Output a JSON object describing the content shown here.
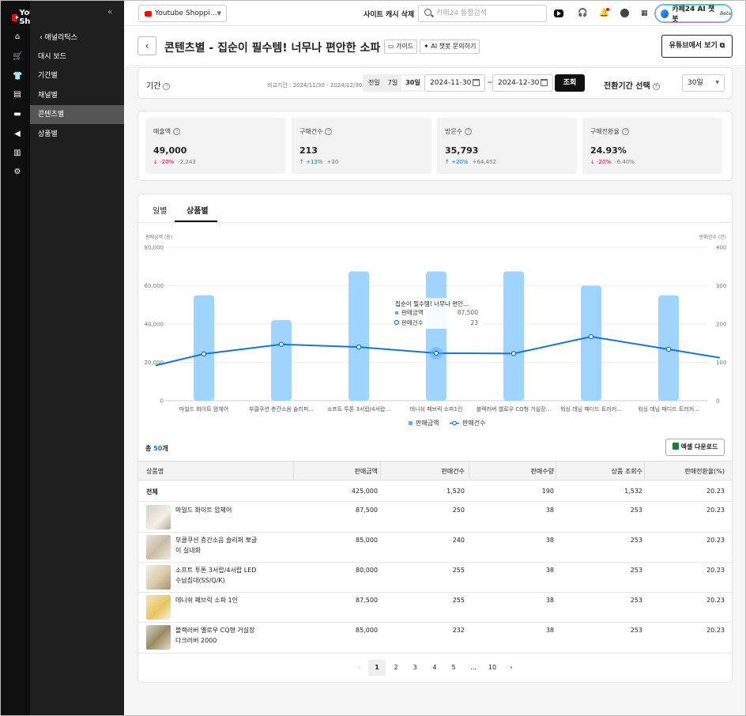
{
  "app": {
    "logo": "YouTube Shopping",
    "collapse": "«"
  },
  "sidebar": {
    "back": "애널리틱스",
    "items": [
      {
        "label": "대시 보드"
      },
      {
        "label": "기간별"
      },
      {
        "label": "채널별"
      },
      {
        "label": "콘텐츠별"
      },
      {
        "label": "상품별"
      }
    ]
  },
  "topbar": {
    "mall": "Youtube Shoppi…",
    "cache": "사이트 캐시 삭제",
    "search_placeholder": "카페24 통합검색",
    "ai": "카페24 AI 챗봇",
    "ai_badge": "Beta"
  },
  "header": {
    "title": "콘텐츠별 - 집순이 필수템! 너무나 편안한 소파",
    "guide": "가이드",
    "ai_ask": "AI 챗봇 문의하기",
    "yt_view": "유튜브에서 보기"
  },
  "filter": {
    "label": "기간",
    "compare": "비교기간 : 2024/11/30 - 2024/12/30",
    "ranges": [
      "전일",
      "7일",
      "30일"
    ],
    "start": "2024-11-30",
    "end": "2024-12-30",
    "tilde": "~",
    "search": "조회",
    "conv_label": "전환기간 선택",
    "conv_value": "30일"
  },
  "stats": [
    {
      "label": "매출액",
      "value": "49,000",
      "change": "↓ -20%",
      "abs": "-2,243",
      "dir": "down"
    },
    {
      "label": "구매건수",
      "value": "213",
      "change": "↑ +13%",
      "abs": "+20",
      "dir": "up"
    },
    {
      "label": "방문수",
      "value": "35,793",
      "change": "↑ +20%",
      "abs": "+64,452",
      "dir": "up"
    },
    {
      "label": "구매전환율",
      "value": "24.93%",
      "change": "↓ -20%",
      "abs": "-6.40%",
      "dir": "down"
    }
  ],
  "tabs": [
    "일별",
    "상품별"
  ],
  "chart_data": {
    "type": "bar",
    "ylabel": "판매금액 (원)",
    "y2label": "판매건수 (건)",
    "ylim": [
      0,
      80000
    ],
    "y2lim": [
      0,
      400
    ],
    "yticks": [
      "0",
      "20,000",
      "40,000",
      "60,000",
      "80,000"
    ],
    "y2ticks": [
      "0",
      "100",
      "200",
      "300",
      "400"
    ],
    "categories": [
      "마일드 화이트 암체어",
      "부클쿠션 층간소음 슬리퍼...",
      "소프트 투톤 3서랍/4서랍...",
      "데니쉬 패브릭 소파1인",
      "블랙러버 옐로우 CQ형 거실장...",
      "워싱 데님 패디드 트러커...",
      "워싱 데님 패디드 트러커..."
    ],
    "series": [
      {
        "name": "판매금액",
        "type": "bar",
        "values": [
          55000,
          42000,
          67500,
          67500,
          67500,
          60000,
          55000
        ],
        "color": "#9ed4ff"
      },
      {
        "name": "판매건수",
        "type": "line",
        "values": [
          122,
          147,
          140,
          124,
          123,
          167,
          134
        ],
        "color": "#1477d6"
      }
    ],
    "line_edges": [
      92,
      112
    ],
    "tooltip": {
      "title": "집순이 필수템! 너무나 편안...",
      "rows": [
        {
          "label": "판매금액",
          "value": "87,500"
        },
        {
          "label": "판매건수",
          "value": "23"
        }
      ]
    },
    "legend": [
      "판매금액",
      "판매건수"
    ],
    "legend_position": "bottom"
  },
  "table": {
    "total_prefix": "총",
    "total_count": "50",
    "total_suffix": "개",
    "excel": "엑셀 다운로드",
    "headers": [
      "상품명",
      "판매금액",
      "판매건수",
      "판매수량",
      "상품 조회수",
      "판매전환율(%)"
    ],
    "total_row": [
      "전체",
      "425,000",
      "1,520",
      "190",
      "1,532",
      "20.23"
    ],
    "rows": [
      {
        "name": "마일드 화이트 암체어",
        "amount": "87,500",
        "count": "250",
        "qty": "38",
        "views": "253",
        "rate": "20.23"
      },
      {
        "name": "부클쿠션 층간소음 슬리퍼 뽀글이 실내화",
        "amount": "85,000",
        "count": "240",
        "qty": "38",
        "views": "253",
        "rate": "20.23"
      },
      {
        "name": "소프트 투톤 3서랍/4서랍 LED 수납침대(SS/Q/K)",
        "amount": "80,000",
        "count": "255",
        "qty": "38",
        "views": "253",
        "rate": "20.23"
      },
      {
        "name": "데니쉬 패브릭 소파 1인",
        "amount": "87,500",
        "count": "255",
        "qty": "38",
        "views": "253",
        "rate": "20.23"
      },
      {
        "name": "블랙러버 옐로우 CQ형 거실장 다크러버 2000",
        "amount": "85,000",
        "count": "232",
        "qty": "38",
        "views": "253",
        "rate": "20.23"
      }
    ]
  },
  "pagination": {
    "prev": "‹",
    "pages": [
      "1",
      "2",
      "3",
      "4",
      "5",
      "...",
      "10"
    ],
    "next": "›",
    "current": "1"
  }
}
